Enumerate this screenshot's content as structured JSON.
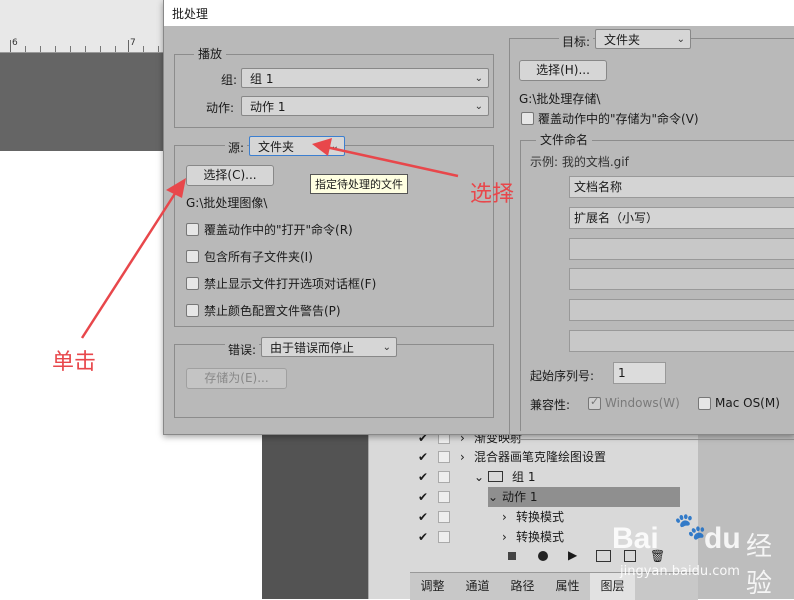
{
  "ruler": {
    "mark_6": "6",
    "mark_7": "7"
  },
  "dialog": {
    "title": "批处理",
    "play": {
      "legend": "播放",
      "set_label": "组:",
      "set_value": "组 1",
      "action_label": "动作:",
      "action_value": "动作 1"
    },
    "source": {
      "label": "源:",
      "value": "文件夹",
      "choose_button": "选择(C)...",
      "tooltip": "指定待处理的文件",
      "path": "G:\\批处理图像\\",
      "options": [
        {
          "label": "覆盖动作中的\"打开\"命令(R)",
          "checked": false
        },
        {
          "label": "包含所有子文件夹(I)",
          "checked": false
        },
        {
          "label": "禁止显示文件打开选项对话框(F)",
          "checked": false
        },
        {
          "label": "禁止颜色配置文件警告(P)",
          "checked": false
        }
      ]
    },
    "errors": {
      "label": "错误:",
      "value": "由于错误而停止",
      "save_as_button": "存储为(E)..."
    },
    "destination": {
      "label": "目标:",
      "value": "文件夹",
      "choose_button": "选择(H)...",
      "path": "G:\\批处理存储\\",
      "override_save_as": "覆盖动作中的\"存储为\"命令(V)",
      "naming": {
        "legend": "文件命名",
        "example": "示例: 我的文档.gif",
        "fields": [
          "文档名称",
          "扩展名（小写）",
          "",
          "",
          "",
          ""
        ],
        "start_serial_label": "起始序列号:",
        "start_serial_value": "1",
        "compat_label": "兼容性:",
        "windows_label": "Windows(W)",
        "windows_checked": true,
        "mac_label": "Mac OS(M)",
        "mac_checked": false
      }
    }
  },
  "actions_panel": {
    "rows": [
      {
        "label": "渐变映射",
        "checked": true,
        "indent": 0
      },
      {
        "label": "混合器画笔克隆绘图设置",
        "checked": true,
        "indent": 0
      },
      {
        "label": "组 1",
        "checked": true,
        "indent": 1,
        "folder": true
      },
      {
        "label": "动作 1",
        "checked": true,
        "indent": 2,
        "selected": true
      },
      {
        "label": "转换模式",
        "checked": true,
        "indent": 3
      },
      {
        "label": "转换模式",
        "checked": true,
        "indent": 3
      }
    ],
    "tabs": [
      "调整",
      "通道",
      "路径",
      "属性",
      "图层"
    ]
  },
  "annotations": {
    "click": "单击",
    "choose": "选择"
  },
  "watermark": {
    "brand": "Bai",
    "brand_suffix": "du",
    "site_cn": "经验",
    "site_url": "jingyan.baidu.com"
  },
  "colors": {
    "annotation": "#e8474b",
    "dialog_bg": "#b9b9b9",
    "tooltip_bg": "#ffffe1"
  }
}
